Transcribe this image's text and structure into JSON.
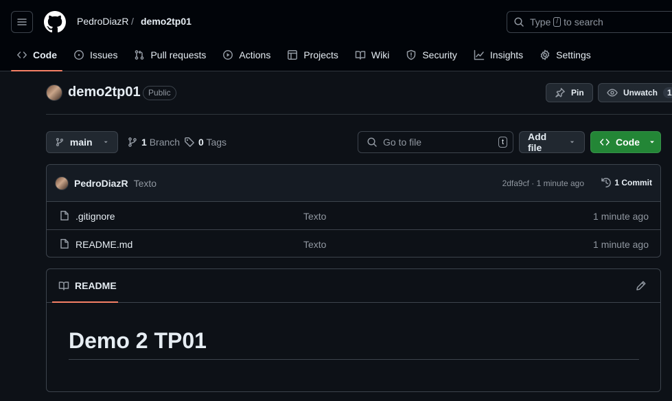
{
  "header": {
    "owner": "PedroDiazR",
    "separator": "/",
    "repo": "demo2tp01",
    "search": {
      "prefix": "Type",
      "key": "/",
      "suffix": "to search"
    }
  },
  "tabs": [
    {
      "label": "Code",
      "icon": "code-icon",
      "active": true
    },
    {
      "label": "Issues",
      "icon": "issue-icon"
    },
    {
      "label": "Pull requests",
      "icon": "pull-request-icon"
    },
    {
      "label": "Actions",
      "icon": "play-icon"
    },
    {
      "label": "Projects",
      "icon": "table-icon"
    },
    {
      "label": "Wiki",
      "icon": "book-icon"
    },
    {
      "label": "Security",
      "icon": "shield-icon"
    },
    {
      "label": "Insights",
      "icon": "graph-icon"
    },
    {
      "label": "Settings",
      "icon": "gear-icon"
    }
  ],
  "repo": {
    "name": "demo2tp01",
    "visibility": "Public",
    "pin_label": "Pin",
    "watch_label": "Unwatch",
    "watch_count": "1"
  },
  "toolbar": {
    "branch": "main",
    "branches_count": "1",
    "branches_label": "Branch",
    "tags_count": "0",
    "tags_label": "Tags",
    "goto_placeholder": "Go to file",
    "goto_key": "t",
    "add_file_label": "Add file",
    "code_label": "Code"
  },
  "latest_commit": {
    "author": "PedroDiazR",
    "message": "Texto",
    "meta": "2dfa9cf · 1 minute ago",
    "count_label": "1 Commit"
  },
  "files": [
    {
      "name": ".gitignore",
      "message": "Texto",
      "time": "1 minute ago"
    },
    {
      "name": "README.md",
      "message": "Texto",
      "time": "1 minute ago"
    }
  ],
  "readme": {
    "tab_label": "README",
    "heading": "Demo 2 TP01"
  },
  "colors": {
    "background": "#0d1117",
    "header": "#010409",
    "accent_underline": "#f78166",
    "code_button": "#238636",
    "border": "#3d444d"
  }
}
